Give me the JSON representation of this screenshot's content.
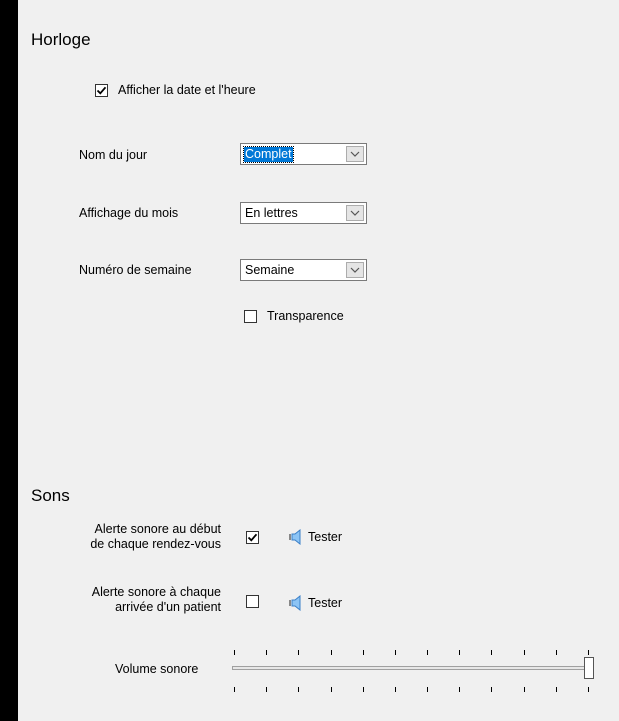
{
  "horloge": {
    "title": "Horloge",
    "show_date_time": {
      "label": "Afficher la date et l'heure",
      "checked": true
    },
    "day_name": {
      "label": "Nom du jour",
      "value": "Complet"
    },
    "month_display": {
      "label": "Affichage du mois",
      "value": "En lettres"
    },
    "week_number": {
      "label": "Numéro de semaine",
      "value": "Semaine"
    },
    "transparency": {
      "label": "Transparence",
      "checked": false
    }
  },
  "sons": {
    "title": "Sons",
    "alert_appointment": {
      "label_line1": "Alerte sonore au début",
      "label_line2": "de chaque rendez-vous",
      "checked": true,
      "test_label": "Tester"
    },
    "alert_patient": {
      "label_line1": "Alerte sonore à chaque",
      "label_line2": "arrivée d'un patient",
      "checked": false,
      "test_label": "Tester"
    },
    "volume": {
      "label": "Volume sonore",
      "level_fraction": 1.0,
      "tick_count": 12
    }
  },
  "icons": {
    "checkmark": "check-icon",
    "speaker": "speaker-icon",
    "dropdown": "chevron-down-icon"
  },
  "colors": {
    "panel_bg": "#f0f0f0",
    "outer_bg": "#000000",
    "selection": "#0078d7",
    "speaker": "#5aa0e0"
  }
}
